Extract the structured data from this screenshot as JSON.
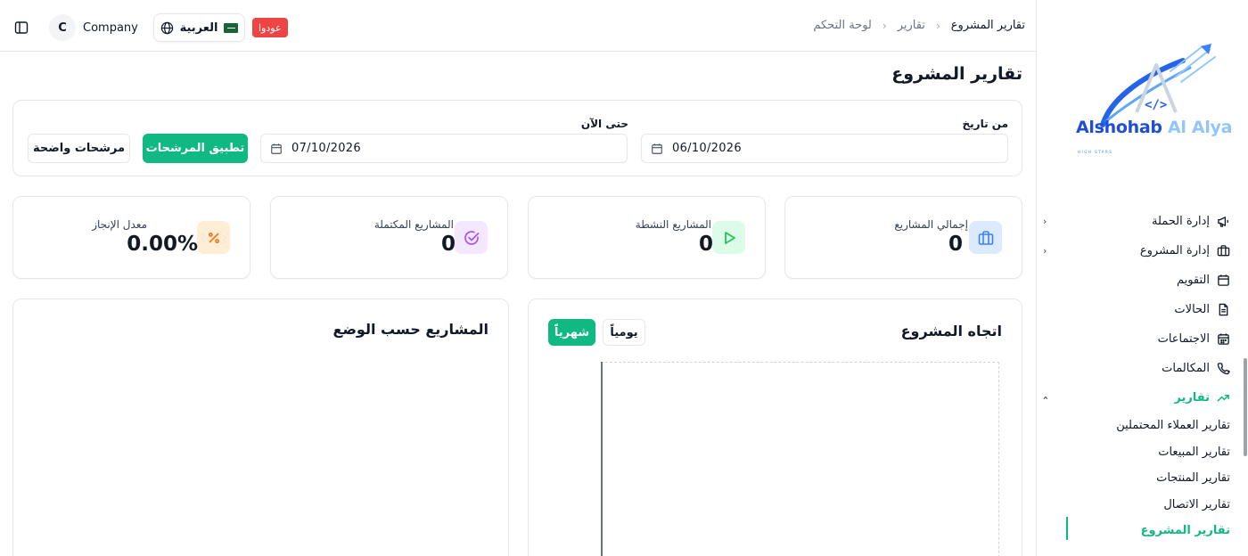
{
  "topbar": {
    "company_initial": "C",
    "company_name": "Company",
    "language_label": "العربية",
    "badge_label": "عودوا"
  },
  "breadcrumb": {
    "items": [
      "لوحة التحكم",
      "تقارير",
      "تقارير المشروع"
    ]
  },
  "page": {
    "title": "تقارير المشروع"
  },
  "filters": {
    "from_label": "من تاريخ",
    "from_value": "06/10/2026",
    "to_label": "حتى الآن",
    "to_value": "07/10/2026",
    "apply_label": "تطبيق المرشحات",
    "clear_label": "مرشحات واضحة"
  },
  "stats": [
    {
      "label": "إجمالي المشاريع",
      "value": "0",
      "icon": "briefcase-icon",
      "color": "#3b82f6"
    },
    {
      "label": "المشاريع النشطة",
      "value": "0",
      "icon": "play-icon",
      "color": "#22c55e"
    },
    {
      "label": "المشاريع المكتملة",
      "value": "0",
      "icon": "check-circle-icon",
      "color": "#a855f7"
    },
    {
      "label": "معدل الإنجاز",
      "value": "0.00%",
      "icon": "percent-icon",
      "color": "#f97316"
    }
  ],
  "trend_panel": {
    "title": "اتجاه المشروع",
    "daily_label": "يومياً",
    "monthly_label": "شهرياً",
    "selected": "monthly"
  },
  "status_panel": {
    "title": "المشاريع حسب الوضع"
  },
  "logo": {
    "text_a": "Alshohab",
    "text_b": "Al Alya",
    "tagline": "HIGH STARS"
  },
  "sidebar": {
    "items": [
      {
        "label": "إدارة الحملة",
        "icon": "megaphone-icon",
        "has_children": true
      },
      {
        "label": "إدارة المشروع",
        "icon": "briefcase-icon",
        "has_children": true
      },
      {
        "label": "التقويم",
        "icon": "calendar-icon",
        "has_children": false
      },
      {
        "label": "الحالات",
        "icon": "document-icon",
        "has_children": false
      },
      {
        "label": "الاجتماعات",
        "icon": "calendar-grid-icon",
        "has_children": false
      },
      {
        "label": "المكالمات",
        "icon": "phone-icon",
        "has_children": false
      },
      {
        "label": "تقارير",
        "icon": "trending-up-icon",
        "has_children": true,
        "expanded": true
      }
    ],
    "report_subitems": [
      "تقارير العملاء المحتملين",
      "تقارير المبيعات",
      "تقارير المنتجات",
      "تقارير الاتصال",
      "تقارير المشروع"
    ],
    "active_subitem": "تقارير المشروع",
    "accent_color": "#10b981"
  }
}
